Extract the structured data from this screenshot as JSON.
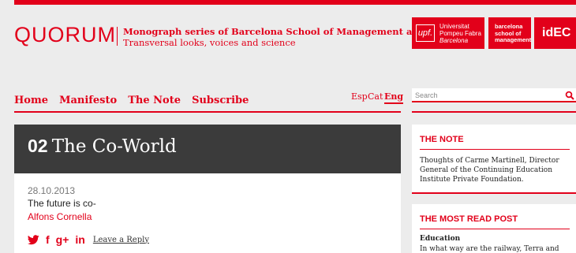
{
  "header": {
    "brand": "QUORUM",
    "tagline_1": "Monograph series of Barcelona School of Management and IDEC-UPF",
    "tagline_2": "Transversal looks, voices and science",
    "logos": {
      "upf_mark": "upf.",
      "upf_line1": "Universitat",
      "upf_line2": "Pompeu Fabra",
      "upf_line3": "Barcelona",
      "bsm_line1": "barcelona",
      "bsm_line2": "school of",
      "bsm_line3": "management",
      "idec": "idEC"
    }
  },
  "nav": {
    "items": [
      "Home",
      "Manifesto",
      "The Note",
      "Subscribe"
    ],
    "languages": [
      "Esp",
      "Cat",
      "Eng"
    ],
    "active_language": "Eng"
  },
  "search": {
    "placeholder": "Search"
  },
  "main": {
    "issue_number": "02",
    "issue_title": "The Co-World",
    "date": "28.10.2013",
    "post_title": "The future is co-",
    "author": "Alfons Cornella",
    "reply_label": "Leave a Reply",
    "social_icons": [
      "twitter-icon",
      "facebook-icon",
      "google-plus-icon",
      "linkedin-icon"
    ]
  },
  "sidebar": {
    "note_heading": "THE NOTE",
    "note_text": "Thoughts of Carme Martinell, Director General of the Continuing Education Institute Private Foundation.",
    "most_read_heading": "THE MOST READ POST",
    "most_read_title": "Education",
    "most_read_text": "In what way are the railway, Terra and online education alike?"
  },
  "colors": {
    "accent": "#e2001a",
    "dark": "#3b3b3b",
    "background": "#ececec"
  }
}
